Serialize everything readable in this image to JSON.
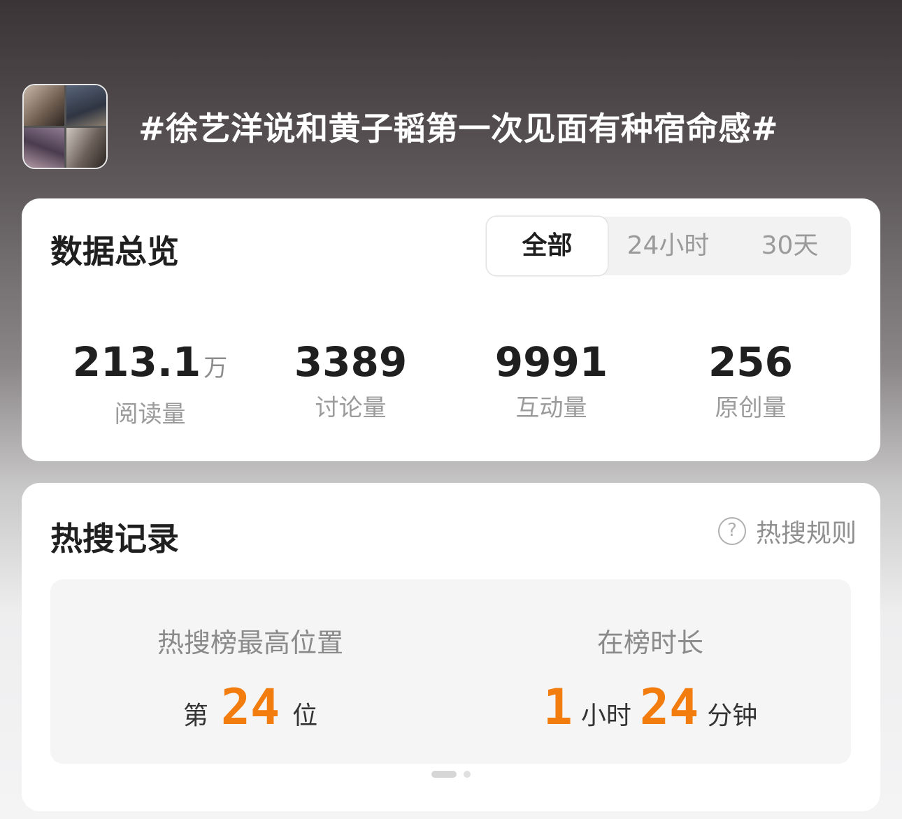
{
  "topic": {
    "title": "#徐艺洋说和黄子韬第一次见面有种宿命感#",
    "thumbnail_icon": "topic-collage-thumbnail"
  },
  "overview": {
    "title": "数据总览",
    "tabs": [
      "全部",
      "24小时",
      "30天"
    ],
    "active_tab": "全部",
    "stats": [
      {
        "value": "213.1",
        "unit": "万",
        "label": "阅读量"
      },
      {
        "value": "3389",
        "unit": "",
        "label": "讨论量"
      },
      {
        "value": "9991",
        "unit": "",
        "label": "互动量"
      },
      {
        "value": "256",
        "unit": "",
        "label": "原创量"
      }
    ]
  },
  "hot_search": {
    "title": "热搜记录",
    "rules_label": "热搜规则",
    "rules_icon": "question-circle-icon",
    "highest": {
      "label": "热搜榜最高位置",
      "prefix": "第",
      "value": "24",
      "suffix": "位"
    },
    "duration": {
      "label": "在榜时长",
      "hours": "1",
      "hours_unit": "小时",
      "minutes": "24",
      "minutes_unit": "分钟"
    },
    "accent_color": "#f27c0e"
  },
  "pager": {
    "pages": 2,
    "current": 1
  }
}
